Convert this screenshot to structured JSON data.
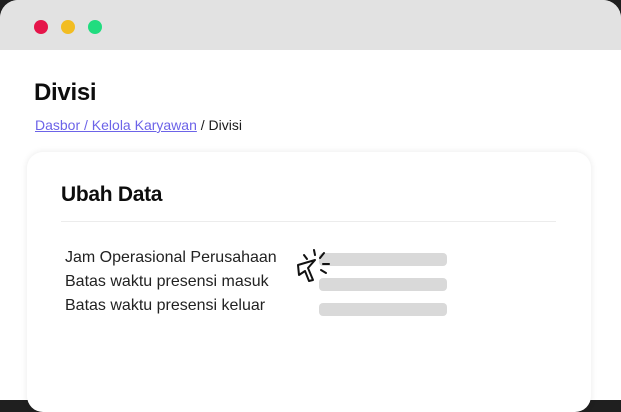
{
  "window": {
    "controls": [
      "close",
      "minimize",
      "maximize"
    ],
    "colors": {
      "close": "#e5154a",
      "minimize": "#f2bd22",
      "maximize": "#21dc7f"
    }
  },
  "header": {
    "title": "Divisi",
    "breadcrumb": {
      "links": [
        "Dasbor",
        "Kelola Karyawan"
      ],
      "link_text": "Dasbor / Kelola Karyawan",
      "separator": " / ",
      "current": "Divisi"
    }
  },
  "form": {
    "title": "Ubah Data",
    "fields": [
      {
        "label": "Jam Operasional Perusahaan",
        "value": ""
      },
      {
        "label": "Batas waktu presensi masuk",
        "value": ""
      },
      {
        "label": "Batas waktu presensi keluar",
        "value": ""
      }
    ]
  },
  "icons": {
    "pointer": "click-cursor-icon"
  },
  "colors": {
    "link": "#6c63e8",
    "titlebar": "#e2e2e2",
    "input_placeholder": "#d9d9d9"
  }
}
